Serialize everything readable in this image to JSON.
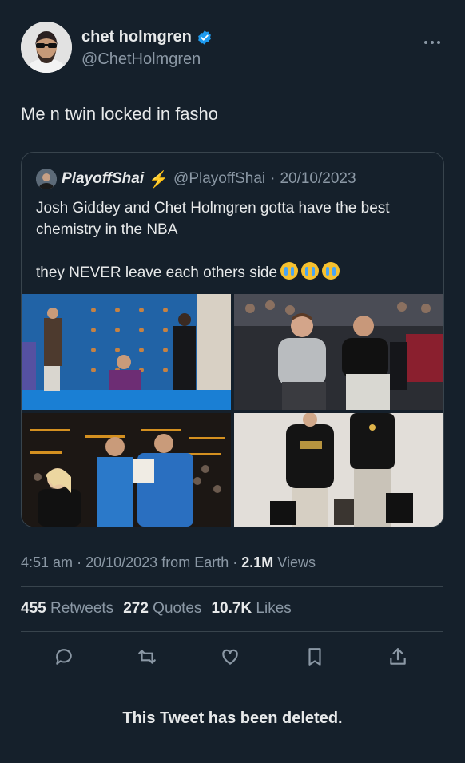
{
  "author": {
    "display_name": "chet holmgren",
    "handle": "@ChetHolmgren",
    "verified_icon": "verified-badge-icon"
  },
  "more_icon": "ellipsis-icon",
  "tweet": {
    "text": "Me n twin locked in fasho"
  },
  "quoted_tweet": {
    "display_name": "PlayoffShai",
    "bolt_icon": "⚡",
    "handle": "@PlayoffShai",
    "separator": "·",
    "date": "20/10/2023",
    "text": "Josh Giddey and Chet Holmgren gotta have the best chemistry in the NBA\n\nthey NEVER leave each others side",
    "emoji_count": 3
  },
  "meta": {
    "time": "4:51 am",
    "sep1": "·",
    "date": "20/10/2023",
    "source": "from Earth",
    "sep2": "·",
    "views_count": "2.1M",
    "views_label": "Views"
  },
  "stats": {
    "retweets_count": "455",
    "retweets_label": "Retweets",
    "quotes_count": "272",
    "quotes_label": "Quotes",
    "likes_count": "10.7K",
    "likes_label": "Likes"
  },
  "actions": [
    "reply-icon",
    "retweet-icon",
    "like-icon",
    "bookmark-icon",
    "share-icon"
  ],
  "deleted_notice": "This Tweet has been deleted.",
  "colors": {
    "background": "#15202b",
    "text": "#e7e9ea",
    "secondary": "#8b98a5",
    "border": "#38444d",
    "verified": "#1d9bf0"
  }
}
